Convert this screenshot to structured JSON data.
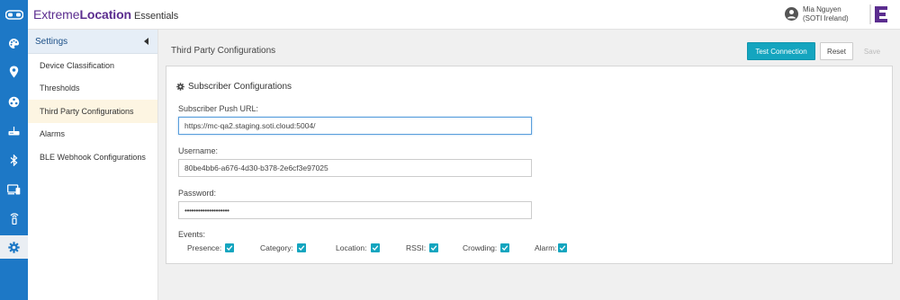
{
  "header": {
    "brand_light": "Extreme",
    "brand_bold": "Location",
    "brand_sub": "Essentials",
    "user_name": "Mia Nguyen",
    "user_org": "(SOTI Ireland)"
  },
  "rail": {
    "items": [
      "palette-icon",
      "location-pin-icon",
      "network-icon",
      "router-icon",
      "bluetooth-icon",
      "devices-icon",
      "beacon-icon",
      "gear-icon"
    ],
    "active_index": 7
  },
  "submenu": {
    "title": "Settings",
    "items": [
      "Device Classification",
      "Thresholds",
      "Third Party Configurations",
      "Alarms",
      "BLE Webhook Configurations"
    ],
    "active_index": 2
  },
  "main": {
    "title": "Third Party Configurations",
    "buttons": {
      "test": "Test Connection",
      "reset": "Reset",
      "save": "Save"
    },
    "panel_title": "Subscriber Configurations",
    "fields": {
      "push_url_label": "Subscriber Push URL:",
      "push_url_value": "https://mc-qa2.staging.soti.cloud:5004/",
      "username_label": "Username:",
      "username_value": "80be4bb6-a676-4d30-b378-2e6cf3e97025",
      "password_label": "Password:",
      "password_value": "••••••••••••••••••••"
    },
    "events_label": "Events:",
    "events": [
      {
        "label": "Presence:",
        "checked": true
      },
      {
        "label": "Category:",
        "checked": true
      },
      {
        "label": "Location:",
        "checked": true
      },
      {
        "label": "RSSI:",
        "checked": true
      },
      {
        "label": "Crowding:",
        "checked": true
      },
      {
        "label": "Alarm:",
        "checked": true
      }
    ]
  },
  "colors": {
    "rail": "#1d78c6",
    "accent": "#14a5bf",
    "brand": "#5b2d8f"
  }
}
